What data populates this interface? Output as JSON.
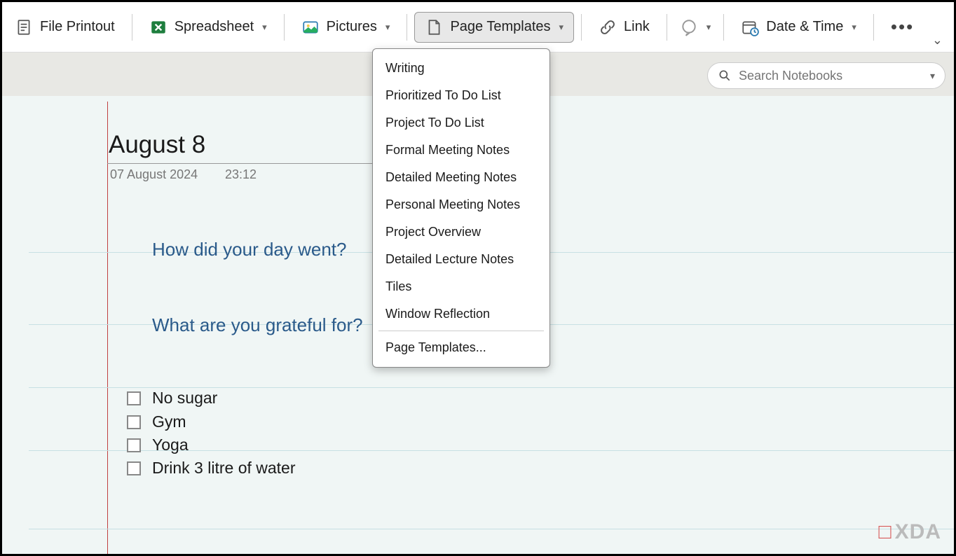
{
  "toolbar": {
    "file_printout": "File Printout",
    "spreadsheet": "Spreadsheet",
    "pictures": "Pictures",
    "page_templates": "Page Templates",
    "link": "Link",
    "date_time": "Date & Time"
  },
  "search": {
    "placeholder": "Search Notebooks"
  },
  "page": {
    "title": "August 8",
    "date": "07 August 2024",
    "time": "23:12",
    "prompt1": "How did your day went?",
    "prompt2": "What are you grateful for?",
    "todos": [
      "No sugar",
      "Gym",
      "Yoga",
      "Drink 3 litre of water"
    ]
  },
  "dropdown": {
    "items": [
      "Writing",
      "Prioritized To Do List",
      "Project To Do List",
      "Formal Meeting Notes",
      "Detailed Meeting Notes",
      "Personal Meeting Notes",
      "Project Overview",
      "Detailed Lecture Notes",
      "Tiles",
      "Window Reflection"
    ],
    "footer": "Page Templates..."
  },
  "watermark": "XDA"
}
